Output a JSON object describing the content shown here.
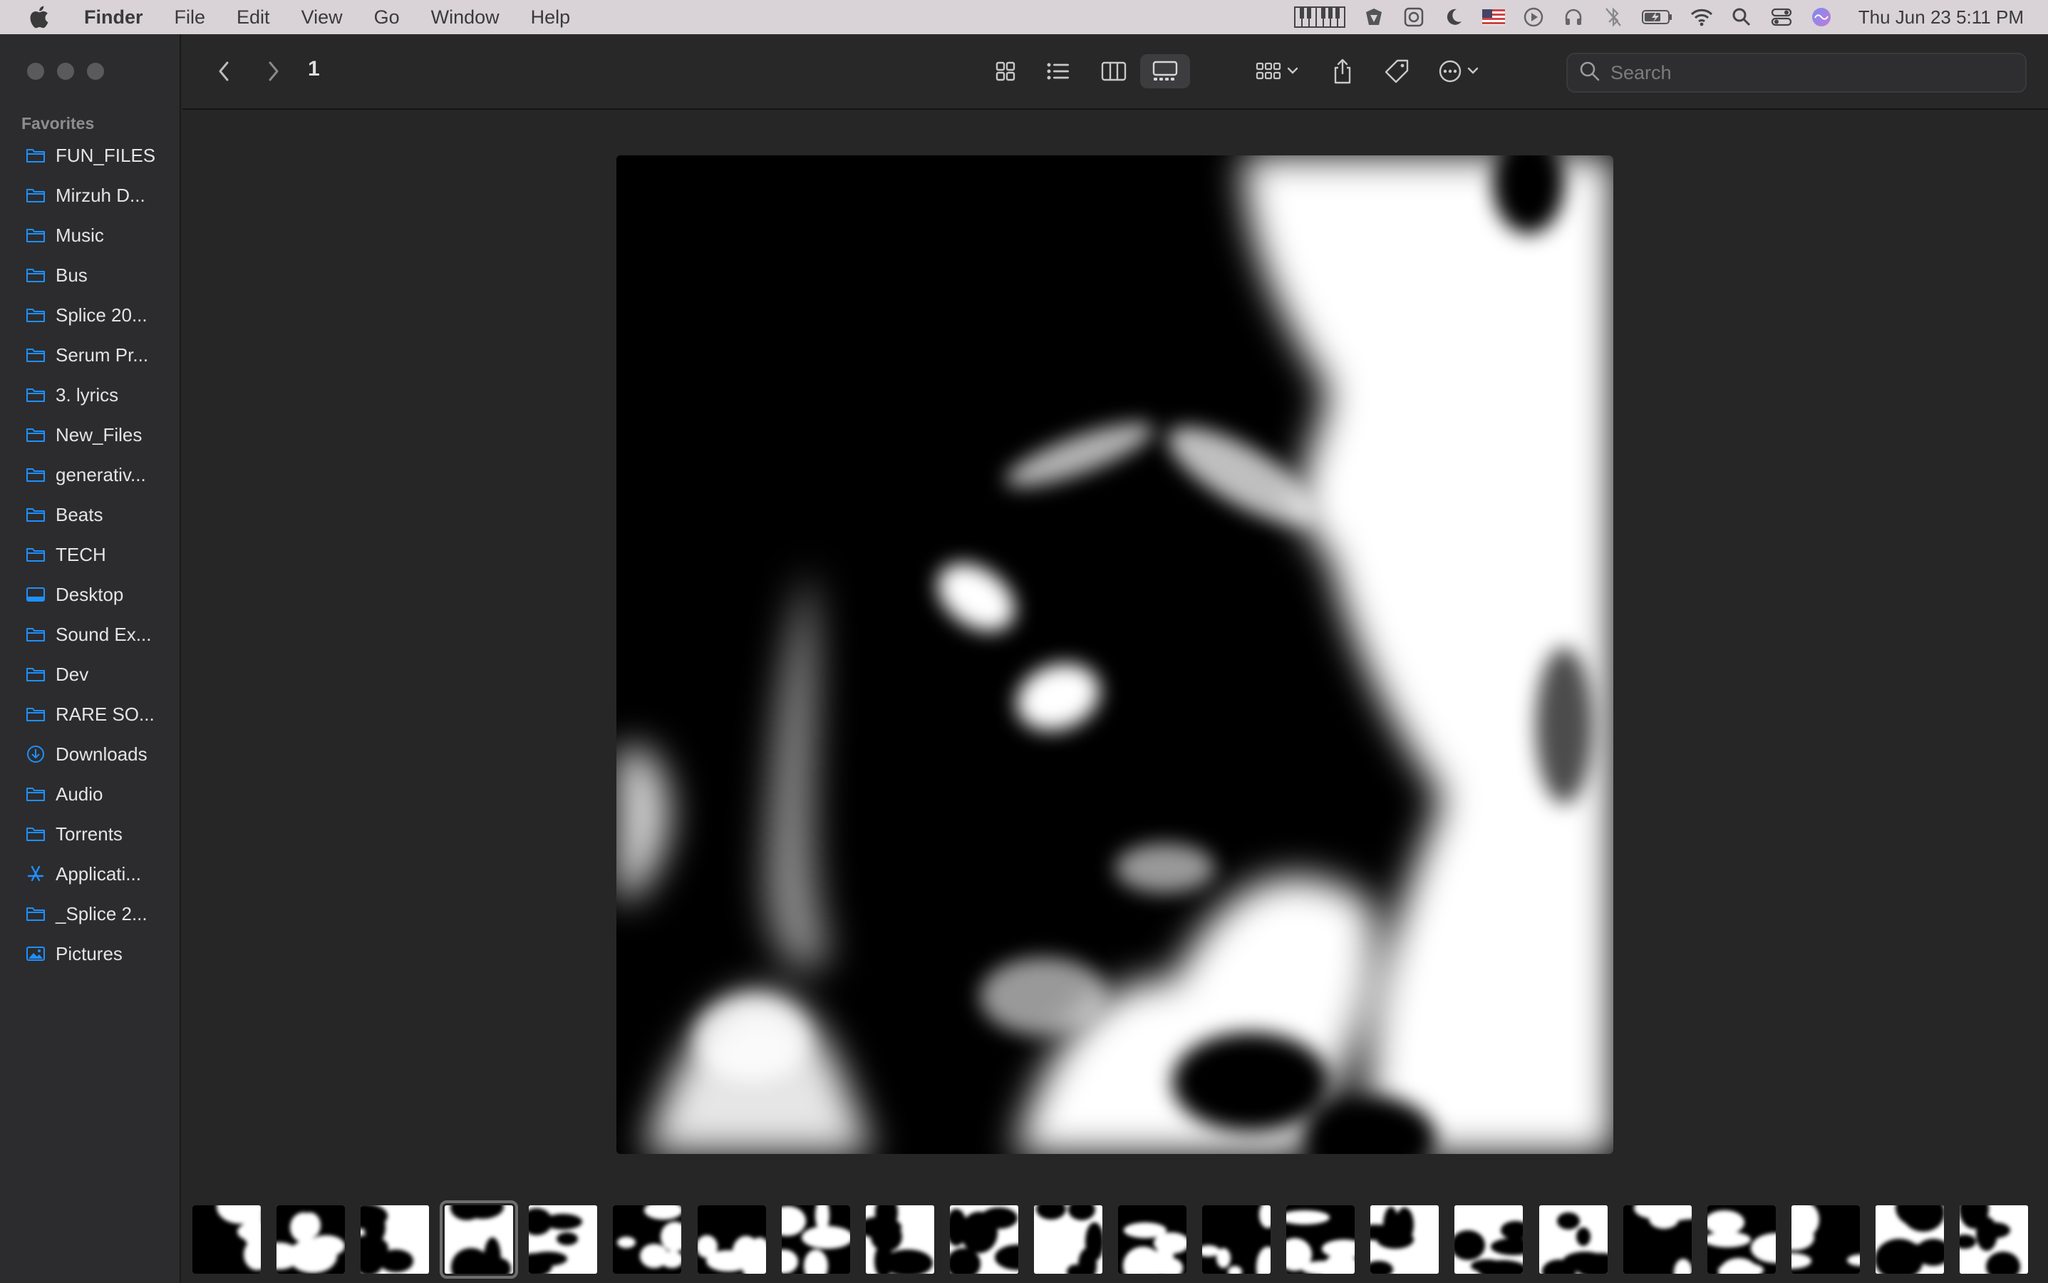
{
  "menubar": {
    "app_name": "Finder",
    "menus": [
      "File",
      "Edit",
      "View",
      "Go",
      "Window",
      "Help"
    ],
    "clock": "Thu Jun 23  5:11 PM",
    "status_icons": [
      "piano-keys-icon",
      "app-icon",
      "app-icon",
      "moon-icon",
      "us-flag-icon",
      "play-icon",
      "headphones-icon",
      "bluetooth-off-icon",
      "battery-icon",
      "wifi-icon",
      "spotlight-icon",
      "control-center-icon",
      "siri-icon"
    ]
  },
  "toolbar": {
    "folder_title": "1",
    "search_placeholder": "Search",
    "views": [
      "icon-view",
      "list-view",
      "column-view",
      "gallery-view"
    ],
    "active_view": "gallery-view"
  },
  "sidebar": {
    "section": "Favorites",
    "items": [
      {
        "label": "FUN_FILES",
        "icon": "folder-icon"
      },
      {
        "label": "Mirzuh D...",
        "icon": "folder-icon"
      },
      {
        "label": "Music",
        "icon": "folder-icon"
      },
      {
        "label": "Bus",
        "icon": "folder-icon"
      },
      {
        "label": "Splice 20...",
        "icon": "folder-icon"
      },
      {
        "label": "Serum Pr...",
        "icon": "folder-icon"
      },
      {
        "label": "3. lyrics",
        "icon": "folder-icon"
      },
      {
        "label": "New_Files",
        "icon": "folder-icon"
      },
      {
        "label": "generativ...",
        "icon": "folder-icon"
      },
      {
        "label": "Beats",
        "icon": "folder-icon"
      },
      {
        "label": "TECH",
        "icon": "folder-icon"
      },
      {
        "label": "Desktop",
        "icon": "desktop-icon"
      },
      {
        "label": "Sound Ex...",
        "icon": "folder-icon"
      },
      {
        "label": "Dev",
        "icon": "folder-icon"
      },
      {
        "label": "RARE SO...",
        "icon": "folder-icon"
      },
      {
        "label": "Downloads",
        "icon": "downloads-icon"
      },
      {
        "label": "Audio",
        "icon": "folder-icon"
      },
      {
        "label": "Torrents",
        "icon": "folder-icon"
      },
      {
        "label": "Applicati...",
        "icon": "applications-icon"
      },
      {
        "label": "_Splice 2...",
        "icon": "folder-icon"
      },
      {
        "label": "Pictures",
        "icon": "pictures-icon"
      }
    ]
  },
  "filmstrip": {
    "count": 22,
    "selected_index": 3
  },
  "colors": {
    "accent": "#0a84ff",
    "sidebar_bg": "#2c2c2e",
    "window_bg": "#262626",
    "menubar_bg": "#d9d3d7"
  }
}
